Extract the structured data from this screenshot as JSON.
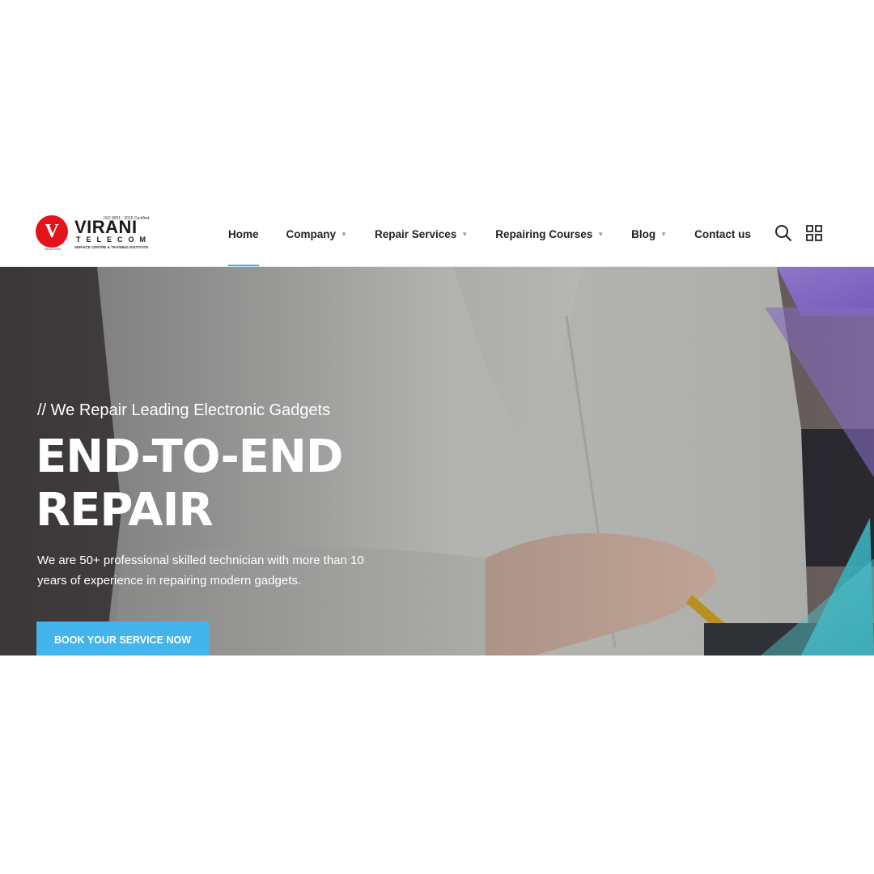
{
  "brand": {
    "badge_letter": "V",
    "since": "Since 2004",
    "iso": "ISO 9001 : 2015 Certified",
    "name": "VIRANI",
    "sub": "TELECOM",
    "tagline": "SERVICE CENTRE & TRAINING INSTITUTE",
    "colors": {
      "badge": "#e4141b",
      "accent": "#43b4ec"
    }
  },
  "nav": {
    "items": [
      {
        "label": "Home",
        "active": true,
        "dropdown": false
      },
      {
        "label": "Company",
        "active": false,
        "dropdown": true
      },
      {
        "label": "Repair Services",
        "active": false,
        "dropdown": true
      },
      {
        "label": "Repairing Courses",
        "active": false,
        "dropdown": true
      },
      {
        "label": "Blog",
        "active": false,
        "dropdown": true
      },
      {
        "label": "Contact us",
        "active": false,
        "dropdown": false
      }
    ],
    "caret": "▼",
    "icons": [
      "search-icon",
      "grid-menu-icon"
    ]
  },
  "hero": {
    "kicker": "// We Repair Leading Electronic Gadgets",
    "title_line1": "END-TO-END",
    "title_line2": "REPAIR",
    "description": "We are 50+ professional skilled technician with more than 10 years of experience in repairing modern gadgets.",
    "cta": "BOOK YOUR SERVICE NOW"
  }
}
